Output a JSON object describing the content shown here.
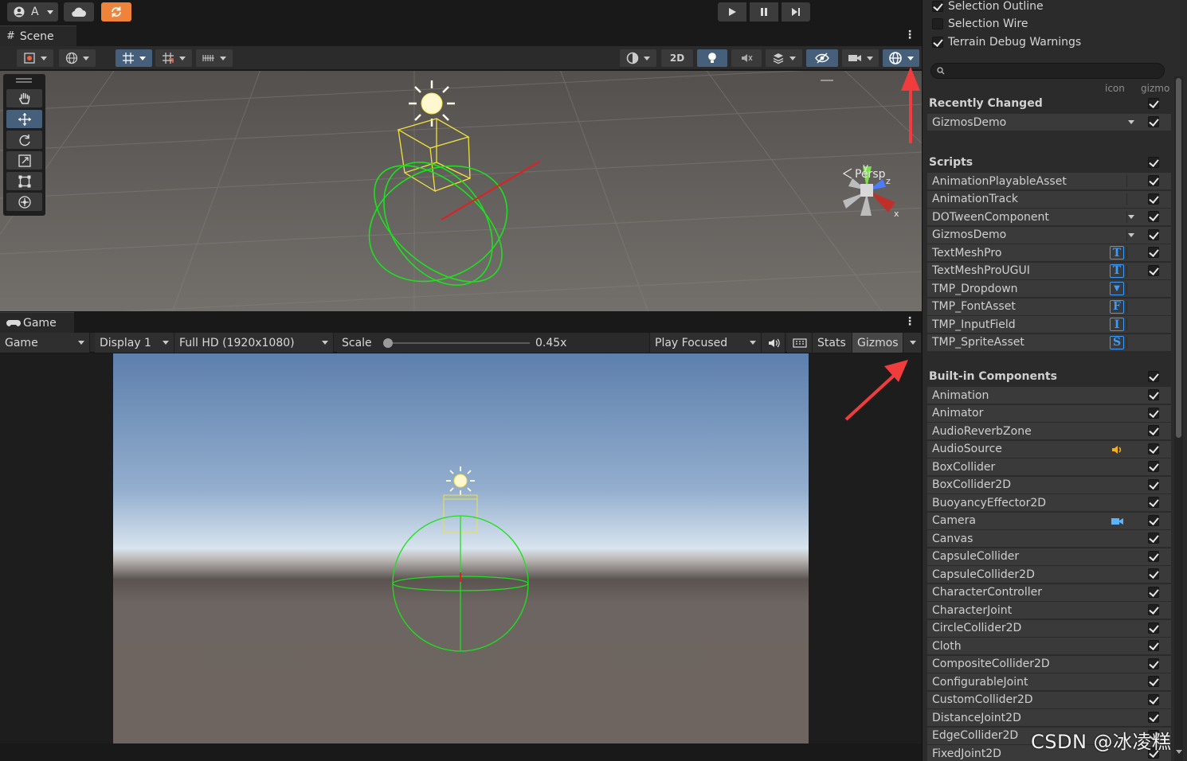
{
  "topbar": {
    "account_label": "A"
  },
  "scene_tab": {
    "label": "Scene"
  },
  "scene_toolbar": {
    "mode_2d": "2D"
  },
  "scene_view": {
    "persp_label": "Persp",
    "axis_y": "y",
    "axis_z": "z",
    "axis_x": "x"
  },
  "game_tab": {
    "label": "Game"
  },
  "game_toolbar": {
    "view_select": "Game",
    "display_select": "Display 1",
    "resolution_select": "Full HD (1920x1080)",
    "scale_label": "Scale",
    "scale_value": "0.45x",
    "scale_fraction": 0.02,
    "play_mode_select": "Play Focused",
    "stats_label": "Stats",
    "gizmos_label": "Gizmos"
  },
  "gizmo_panel": {
    "options": [
      {
        "label": "Selection Outline",
        "checked": true
      },
      {
        "label": "Selection Wire",
        "checked": false
      },
      {
        "label": "Terrain Debug Warnings",
        "checked": true
      }
    ],
    "col_icon": "icon",
    "col_gizmo": "gizmo",
    "recently_changed": {
      "title": "Recently Changed",
      "items": [
        {
          "label": "GizmosDemo",
          "dropdown": true,
          "icon": "",
          "checked": true
        }
      ]
    },
    "scripts": {
      "title": "Scripts",
      "items": [
        {
          "label": "AnimationPlayableAsset",
          "dropdown": false,
          "icon": "",
          "checked": true
        },
        {
          "label": "AnimationTrack",
          "dropdown": false,
          "icon": "",
          "checked": true
        },
        {
          "label": "DOTweenComponent",
          "dropdown": true,
          "icon": "",
          "checked": true
        },
        {
          "label": "GizmosDemo",
          "dropdown": true,
          "icon": "",
          "checked": true
        },
        {
          "label": "TextMeshPro",
          "dropdown": false,
          "icon": "T",
          "checked": true
        },
        {
          "label": "TextMeshProUGUI",
          "dropdown": false,
          "icon": "T",
          "checked": true
        },
        {
          "label": "TMP_Dropdown",
          "dropdown": false,
          "icon": "▼",
          "checked": null
        },
        {
          "label": "TMP_FontAsset",
          "dropdown": false,
          "icon": "F",
          "checked": null
        },
        {
          "label": "TMP_InputField",
          "dropdown": false,
          "icon": "I",
          "checked": null
        },
        {
          "label": "TMP_SpriteAsset",
          "dropdown": false,
          "icon": "S",
          "checked": null
        }
      ]
    },
    "builtin": {
      "title": "Built-in Components",
      "items": [
        {
          "label": "Animation",
          "icon": "",
          "checked": true
        },
        {
          "label": "Animator",
          "icon": "",
          "checked": true
        },
        {
          "label": "AudioReverbZone",
          "icon": "",
          "checked": true
        },
        {
          "label": "AudioSource",
          "icon": "speaker-icon",
          "checked": true
        },
        {
          "label": "BoxCollider",
          "icon": "",
          "checked": true
        },
        {
          "label": "BoxCollider2D",
          "icon": "",
          "checked": true
        },
        {
          "label": "BuoyancyEffector2D",
          "icon": "",
          "checked": true
        },
        {
          "label": "Camera",
          "icon": "camera-icon",
          "checked": true
        },
        {
          "label": "Canvas",
          "icon": "",
          "checked": true
        },
        {
          "label": "CapsuleCollider",
          "icon": "",
          "checked": true
        },
        {
          "label": "CapsuleCollider2D",
          "icon": "",
          "checked": true
        },
        {
          "label": "CharacterController",
          "icon": "",
          "checked": true
        },
        {
          "label": "CharacterJoint",
          "icon": "",
          "checked": true
        },
        {
          "label": "CircleCollider2D",
          "icon": "",
          "checked": true
        },
        {
          "label": "Cloth",
          "icon": "",
          "checked": true
        },
        {
          "label": "CompositeCollider2D",
          "icon": "",
          "checked": true
        },
        {
          "label": "ConfigurableJoint",
          "icon": "",
          "checked": true
        },
        {
          "label": "CustomCollider2D",
          "icon": "",
          "checked": true
        },
        {
          "label": "DistanceJoint2D",
          "icon": "",
          "checked": true
        },
        {
          "label": "EdgeCollider2D",
          "icon": "",
          "checked": true
        },
        {
          "label": "FixedJoint2D",
          "icon": "",
          "checked": true
        }
      ]
    }
  },
  "watermark": "CSDN @冰凌糕",
  "colors": {
    "accent": "#46607c",
    "icon_blue": "#3b9cff",
    "annotation_red": "#f03c3c",
    "gizmo_green": "#1ee01e",
    "gizmo_yellow": "#f0e040"
  }
}
